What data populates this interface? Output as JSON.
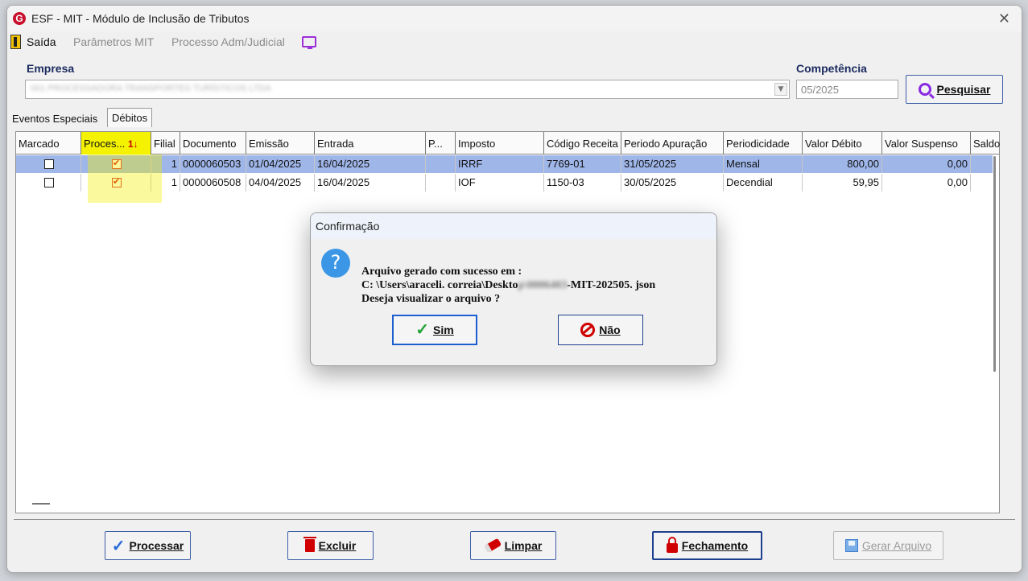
{
  "window": {
    "title": "ESF - MIT - Módulo de Inclusão de Tributos",
    "logo_letter": "G",
    "close_glyph": "✕"
  },
  "menu": {
    "exit": "Saída",
    "params": "Parâmetros MIT",
    "process": "Processo Adm/Judicial"
  },
  "form": {
    "empresa_label": "Empresa",
    "empresa_value": "001 PROCESSADORA TRANSPORTES TURÍSTICOS LTDA",
    "competencia_label": "Competência",
    "competencia_value": "05/2025",
    "search_label": "Pesquisar"
  },
  "tabs": [
    "Eventos Especiais",
    "Débitos"
  ],
  "grid": {
    "columns": [
      "Marcado",
      "Proces...",
      "Filial",
      "Documento",
      "Emissão",
      "Entrada",
      "P...",
      "Imposto",
      "Código Receita",
      "Periodo Apuração",
      "Periodicidade",
      "Valor Débito",
      "Valor Suspenso",
      "Saldo"
    ],
    "sort_indicator": "1",
    "rows": [
      {
        "marcado": false,
        "processar": true,
        "filial": "1",
        "documento": "0000060503",
        "emissao": "01/04/2025",
        "entrada": "16/04/2025",
        "p": "",
        "imposto": "IRRF",
        "codigo_receita": "7769-01",
        "periodo": "31/05/2025",
        "periodicidade": "Mensal",
        "valor_debito": "800,00",
        "valor_suspenso": "0,00",
        "saldo": ""
      },
      {
        "marcado": false,
        "processar": true,
        "filial": "1",
        "documento": "0000060508",
        "emissao": "04/04/2025",
        "entrada": "16/04/2025",
        "p": "",
        "imposto": "IOF",
        "codigo_receita": "1150-03",
        "periodo": "30/05/2025",
        "periodicidade": "Decendial",
        "valor_debito": "59,95",
        "valor_suspenso": "0,00",
        "saldo": ""
      }
    ]
  },
  "dialog": {
    "title": "Confirmação",
    "line1": "Arquivo gerado com sucesso em :",
    "line2_prefix": "C: \\Users\\araceli. correia\\Deskto",
    "line2_blurred": "p\\0006403",
    "line2_suffix": "-MIT-202505. json",
    "line3": "Deseja visualizar o arquivo ?",
    "yes": "Sim",
    "no": "Não"
  },
  "bottom_buttons": {
    "processar": "Processar",
    "excluir": "Excluir",
    "limpar": "Limpar",
    "fechamento": "Fechamento",
    "gerar": "Gerar Arquivo"
  },
  "colors": {
    "accent": "#1d3f8f",
    "selected_row": "#9fb6e9",
    "highlight": "#f4f200",
    "icon_purple": "#8a2be2",
    "icon_red": "#d10000"
  }
}
